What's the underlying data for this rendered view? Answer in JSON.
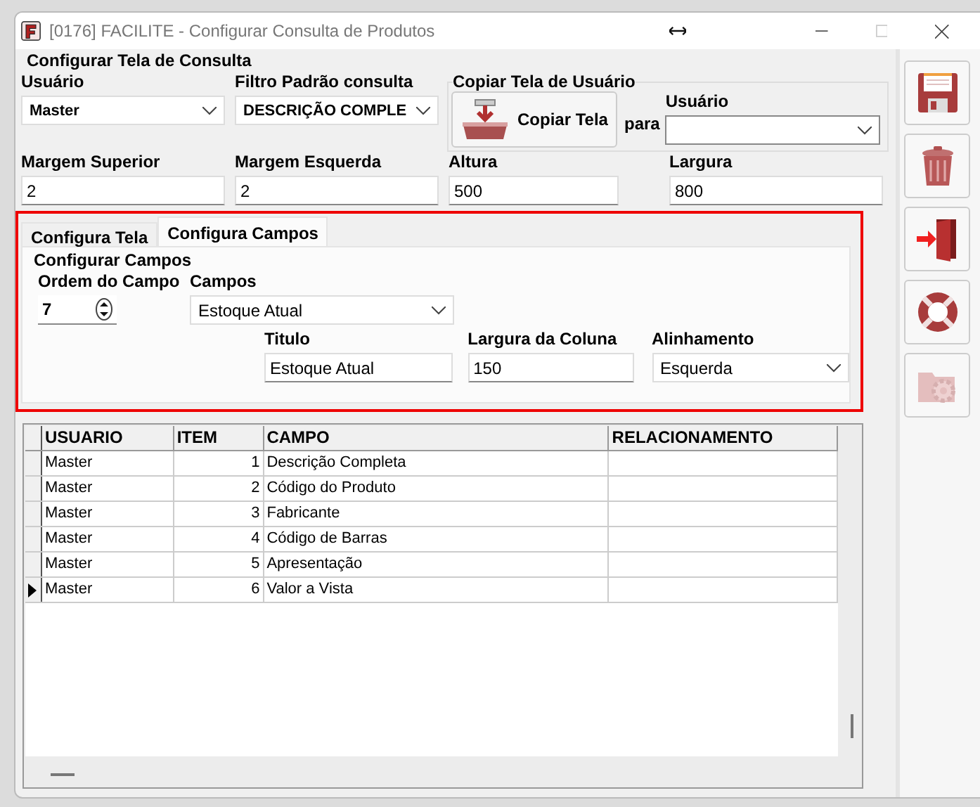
{
  "window": {
    "title": "[0176] FACILITE - Configurar Consulta de Produtos"
  },
  "config": {
    "title": "Configurar Tela de Consulta",
    "usuario": {
      "label": "Usuário",
      "value": "Master"
    },
    "filtro": {
      "label": "Filtro Padrão consulta",
      "value": "DESCRIÇÃO COMPLE"
    },
    "copy_group": {
      "title": "Copiar Tela de Usuário",
      "button": "Copiar Tela",
      "joiner": "para",
      "target_label": "Usuário"
    },
    "margins": [
      {
        "label": "Margem Superior",
        "value": "2"
      },
      {
        "label": "Margem Esquerda",
        "value": "2"
      },
      {
        "label": "Altura",
        "value": "500"
      },
      {
        "label": "Largura",
        "value": "800"
      }
    ]
  },
  "tabs": [
    {
      "label": "Configura Tela",
      "selected": false
    },
    {
      "label": "Configura Campos",
      "selected": true
    }
  ],
  "campos_group": {
    "title": "Configurar Campos",
    "order": {
      "label": "Ordem do Campo",
      "value": "7"
    },
    "campos": {
      "label": "Campos",
      "value": "Estoque Atual"
    },
    "fields": [
      {
        "kind": "text",
        "label": "Titulo",
        "value": "Estoque Atual"
      },
      {
        "kind": "text",
        "label": "Largura da Coluna",
        "value": "150"
      },
      {
        "kind": "select",
        "label": "Alinhamento",
        "value": "Esquerda"
      }
    ]
  },
  "table": {
    "columns": [
      "USUARIO",
      "ITEM",
      "CAMPO",
      "RELACIONAMENTO"
    ],
    "rows": [
      {
        "cells": [
          "Master",
          "1",
          "Descrição Completa"
        ],
        "selected": false
      },
      {
        "cells": [
          "Master",
          "2",
          "Código do Produto"
        ],
        "selected": false
      },
      {
        "cells": [
          "Master",
          "3",
          "Fabricante"
        ],
        "selected": false
      },
      {
        "cells": [
          "Master",
          "4",
          "Código de Barras"
        ],
        "selected": false
      },
      {
        "cells": [
          "Master",
          "5",
          "Apresentação"
        ],
        "selected": false
      },
      {
        "cells": [
          "Master",
          "6",
          "Valor a Vista"
        ],
        "selected": true
      }
    ]
  },
  "toolbar": [
    {
      "kind": "save",
      "disabled": false
    },
    {
      "kind": "delete",
      "disabled": false
    },
    {
      "kind": "exit",
      "disabled": false
    },
    {
      "kind": "help",
      "disabled": false
    },
    {
      "kind": "settings",
      "disabled": true
    }
  ]
}
